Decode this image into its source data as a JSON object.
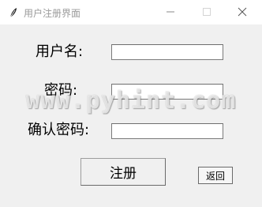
{
  "window": {
    "title": "用户注册界面",
    "icon": "feather-icon"
  },
  "controls": {
    "minimize_icon": "minimize-icon",
    "maximize_icon": "maximize-icon",
    "close_icon": "close-icon"
  },
  "form": {
    "username_label": "用户名:",
    "username_value": "",
    "password_label": "密码:",
    "password_value": "",
    "confirm_label": "确认密码:",
    "confirm_value": ""
  },
  "buttons": {
    "register_label": "注册",
    "back_label": "返回"
  },
  "watermark": "www.pyhint.com"
}
